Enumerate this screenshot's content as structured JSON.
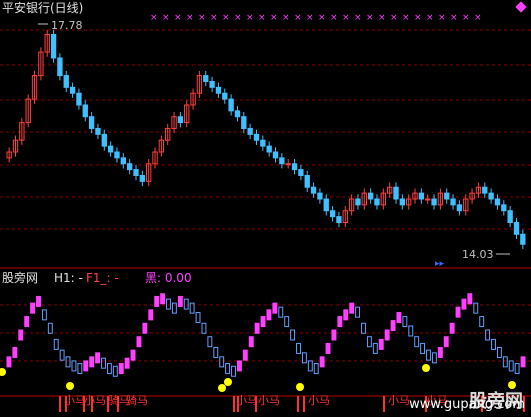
{
  "main_title": "平安银行(日线)",
  "price_high_label": "17.78",
  "price_low_label": "14.03",
  "sub_panel": {
    "name": "股旁网",
    "h1_text": "H1: -",
    "f1_text": "F1_: -",
    "black_text": "黑: 0.00"
  },
  "watermark": {
    "name": "股旁网",
    "url": "www.gupang.com"
  },
  "signal_labels": [
    "小马",
    "小马",
    "骑马",
    "骑马",
    "小马",
    "小马",
    "小马",
    "小马",
    "小马"
  ],
  "colors": {
    "background": "#000000",
    "up": "#ff4040",
    "down": "#40c0ff",
    "grid": "#8b0000",
    "indicator_up": "#ff40ff",
    "indicator_down": "#60a0ff",
    "signal_dot": "#ffff00",
    "signal_bar": "#ff3030"
  },
  "chart_data": [
    {
      "type": "candlestick",
      "title": "平安银行(日线)",
      "y_high": 17.78,
      "y_low": 14.03,
      "closes": [
        15.6,
        15.8,
        16.1,
        16.5,
        16.9,
        17.3,
        17.6,
        17.2,
        16.9,
        16.7,
        16.6,
        16.4,
        16.2,
        16.0,
        15.9,
        15.7,
        15.6,
        15.5,
        15.4,
        15.3,
        15.2,
        15.1,
        15.4,
        15.6,
        15.8,
        16.0,
        16.2,
        16.1,
        16.4,
        16.6,
        16.9,
        16.8,
        16.7,
        16.6,
        16.5,
        16.3,
        16.2,
        16.0,
        15.9,
        15.8,
        15.7,
        15.6,
        15.5,
        15.4,
        15.4,
        15.3,
        15.2,
        15.0,
        14.9,
        14.8,
        14.6,
        14.5,
        14.4,
        14.6,
        14.8,
        14.7,
        14.9,
        14.8,
        14.7,
        14.9,
        15.0,
        14.8,
        14.7,
        14.8,
        14.9,
        14.8,
        14.8,
        14.7,
        14.9,
        14.8,
        14.7,
        14.6,
        14.8,
        14.9,
        15.0,
        14.9,
        14.8,
        14.7,
        14.6,
        14.4,
        14.2,
        14.03
      ]
    },
    {
      "type": "line",
      "title": "股旁网",
      "values": [
        15,
        22,
        35,
        45,
        55,
        60,
        50,
        40,
        28,
        20,
        15,
        12,
        10,
        12,
        15,
        18,
        14,
        10,
        8,
        10,
        14,
        20,
        30,
        40,
        50,
        60,
        62,
        58,
        55,
        60,
        58,
        55,
        48,
        40,
        30,
        22,
        15,
        10,
        8,
        12,
        20,
        30,
        40,
        45,
        50,
        55,
        52,
        45,
        35,
        25,
        18,
        12,
        10,
        15,
        25,
        35,
        45,
        50,
        55,
        52,
        40,
        30,
        25,
        28,
        35,
        42,
        48,
        45,
        38,
        30,
        25,
        20,
        18,
        22,
        30,
        40,
        52,
        58,
        62,
        55,
        45,
        35,
        28,
        22,
        15,
        12,
        10,
        15
      ]
    }
  ]
}
